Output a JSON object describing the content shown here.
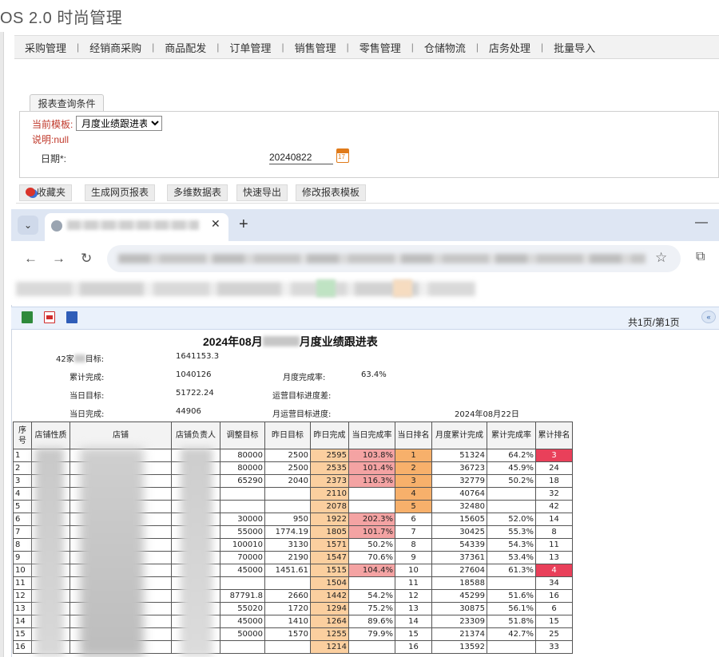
{
  "app": {
    "title": "OS 2.0 时尚管理"
  },
  "menu": [
    "采购管理",
    "经销商采购",
    "商品配发",
    "订单管理",
    "销售管理",
    "零售管理",
    "仓储物流",
    "店务处理",
    "批量导入"
  ],
  "query": {
    "tab_label": "报表查询条件",
    "template_label": "当前模板:",
    "template_value": "月度业绩跟进表",
    "description": "说明:null",
    "date_label": "日期*:",
    "date_value": "20240822"
  },
  "toolbar": [
    "收藏夹",
    "生成网页报表",
    "多维数据表",
    "快速导出",
    "修改报表模板"
  ],
  "browser": {
    "new_tab": "+",
    "close": "✕",
    "minimize": "—"
  },
  "report_bar": {
    "page_info": "共1页/第1页"
  },
  "report": {
    "title_prefix": "2024年08月",
    "title_suffix": "月度业绩跟进表",
    "summary": {
      "target_label_prefix": "42家",
      "target_label_suffix": "目标:",
      "target_value": "1641153.3",
      "cum_label": "累计完成:",
      "cum_value": "1040126",
      "month_rate_label": "月度完成率:",
      "month_rate_value": "63.4%",
      "day_target_label": "当日目标:",
      "day_target_value": "51722.24",
      "op_gap_label": "运营目标进度差:",
      "day_done_label": "当日完成:",
      "day_done_value": "44906",
      "op_progress_label": "月运营目标进度:",
      "report_date": "2024年08月22日"
    },
    "columns": [
      "序号",
      "店铺性质",
      "店铺",
      "店铺负责人",
      "调整目标",
      "昨日目标",
      "昨日完成",
      "当日完成率",
      "当日排名",
      "月度累计完成",
      "累计完成率",
      "累计排名"
    ],
    "rows": [
      [
        "1",
        "",
        "",
        "",
        "80000",
        "2500",
        "2595",
        "103.8%",
        "1",
        "51324",
        "64.2%",
        "3"
      ],
      [
        "2",
        "",
        "",
        "",
        "80000",
        "2500",
        "2535",
        "101.4%",
        "2",
        "36723",
        "45.9%",
        "24"
      ],
      [
        "3",
        "",
        "",
        "",
        "65290",
        "2040",
        "2373",
        "116.3%",
        "3",
        "32779",
        "50.2%",
        "18"
      ],
      [
        "4",
        "",
        "",
        "",
        "",
        "",
        "2110",
        "",
        "4",
        "40764",
        "",
        "32"
      ],
      [
        "5",
        "",
        "",
        "",
        "",
        "",
        "2078",
        "",
        "5",
        "32480",
        "",
        "42"
      ],
      [
        "6",
        "",
        "",
        "",
        "30000",
        "950",
        "1922",
        "202.3%",
        "6",
        "15605",
        "52.0%",
        "14"
      ],
      [
        "7",
        "",
        "",
        "",
        "55000",
        "1774.19",
        "1805",
        "101.7%",
        "7",
        "30425",
        "55.3%",
        "8"
      ],
      [
        "8",
        "",
        "",
        "",
        "100010",
        "3130",
        "1571",
        "50.2%",
        "8",
        "54339",
        "54.3%",
        "11"
      ],
      [
        "9",
        "",
        "",
        "",
        "70000",
        "2190",
        "1547",
        "70.6%",
        "9",
        "37361",
        "53.4%",
        "13"
      ],
      [
        "10",
        "",
        "",
        "",
        "45000",
        "1451.61",
        "1515",
        "104.4%",
        "10",
        "27604",
        "61.3%",
        "4"
      ],
      [
        "11",
        "",
        "",
        "",
        "",
        "",
        "1504",
        "",
        "11",
        "18588",
        "",
        "34"
      ],
      [
        "12",
        "",
        "",
        "",
        "87791.8",
        "2660",
        "1442",
        "54.2%",
        "12",
        "45299",
        "51.6%",
        "16"
      ],
      [
        "13",
        "",
        "",
        "",
        "55020",
        "1720",
        "1294",
        "75.2%",
        "13",
        "30875",
        "56.1%",
        "6"
      ],
      [
        "14",
        "",
        "",
        "",
        "45000",
        "1410",
        "1264",
        "89.6%",
        "14",
        "23309",
        "51.8%",
        "15"
      ],
      [
        "15",
        "",
        "",
        "",
        "50000",
        "1570",
        "1255",
        "79.9%",
        "15",
        "21374",
        "42.7%",
        "25"
      ],
      [
        "16",
        "",
        "",
        "",
        "",
        "",
        "1214",
        "",
        "16",
        "13592",
        "",
        "33"
      ]
    ],
    "highlight": {
      "rate_red_rows": [
        1,
        2,
        3,
        6,
        7,
        10
      ],
      "day_rank_orange_rows": [
        1,
        2,
        3,
        4,
        5
      ],
      "cum_rank_red_rows": [
        1,
        10
      ],
      "orange_color": "#fbcf9f",
      "red_color": "#e9405a"
    }
  }
}
